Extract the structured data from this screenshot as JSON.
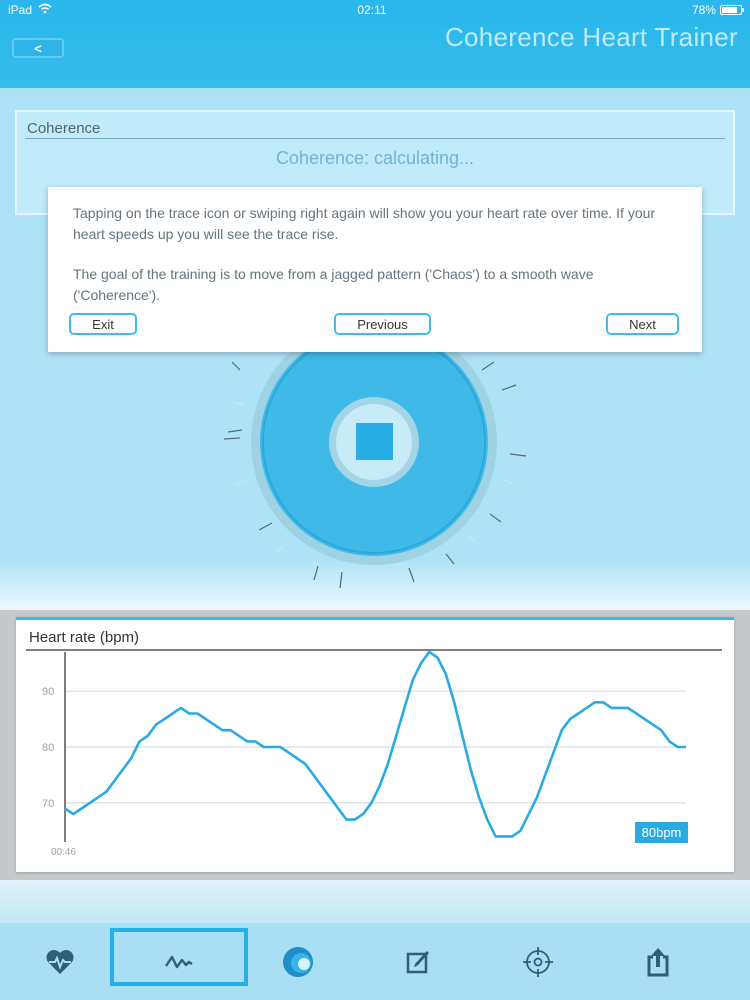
{
  "status_bar": {
    "device": "iPad",
    "time": "02:11",
    "battery": "78%"
  },
  "nav": {
    "back_label": "<",
    "title": "Coherence Heart Trainer"
  },
  "coherence": {
    "header": "Coherence",
    "status": "Coherence: calculating..."
  },
  "tooltip": {
    "paragraph_1": "Tapping on the trace icon or swiping right again will show you your heart rate over time. If your heart speeds up you will see the trace rise.",
    "paragraph_2": "The goal of the training is to move from a jagged pattern ('Chaos') to a smooth wave ('Coherence').",
    "exit_label": "Exit",
    "previous_label": "Previous",
    "next_label": "Next"
  },
  "chart_data": {
    "type": "line",
    "title": "Heart rate (bpm)",
    "x_start_label": "00:46",
    "y_ticks": [
      70,
      80,
      90
    ],
    "ylim": [
      63,
      97
    ],
    "current_value_label": "80bpm",
    "line_color": "#29abe2",
    "grid": true,
    "values": [
      69,
      68,
      69,
      70,
      71,
      72,
      74,
      76,
      78,
      81,
      82,
      84,
      85,
      86,
      87,
      86,
      86,
      85,
      84,
      83,
      83,
      82,
      81,
      81,
      80,
      80,
      80,
      79,
      78,
      77,
      75,
      73,
      71,
      69,
      67,
      67,
      68,
      70,
      73,
      77,
      82,
      87,
      92,
      95,
      97,
      96,
      93,
      88,
      82,
      76,
      71,
      67,
      64,
      64,
      64,
      65,
      68,
      71,
      75,
      79,
      83,
      85,
      86,
      87,
      88,
      88,
      87,
      87,
      87,
      86,
      85,
      84,
      83,
      81,
      80,
      80
    ]
  },
  "tabs": [
    {
      "icon": "heart-rate-icon",
      "selected": false
    },
    {
      "icon": "trace-icon",
      "selected": true
    },
    {
      "icon": "coherence-orb-icon",
      "selected": false
    },
    {
      "icon": "edit-note-icon",
      "selected": false
    },
    {
      "icon": "target-icon",
      "selected": false
    },
    {
      "icon": "share-icon",
      "selected": false
    }
  ],
  "colors": {
    "accent": "#2cb8ec",
    "background": "#aee3f7"
  }
}
